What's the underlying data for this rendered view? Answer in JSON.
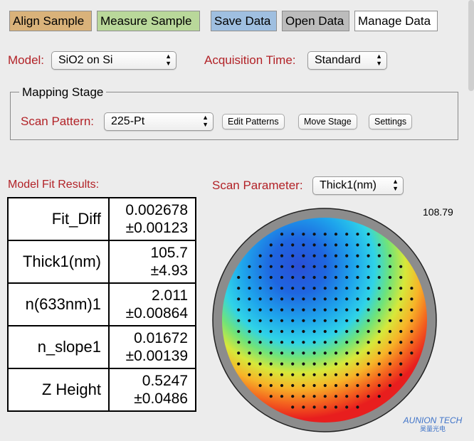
{
  "toolbar": {
    "align_sample": "Align Sample",
    "measure_sample": "Measure Sample",
    "save_data": "Save Data",
    "open_data": "Open Data",
    "manage_data": "Manage Data"
  },
  "model": {
    "label": "Model:",
    "value": "SiO2 on Si"
  },
  "acquisition": {
    "label": "Acquisition Time:",
    "value": "Standard"
  },
  "mapping_stage": {
    "legend": "Mapping Stage",
    "scan_pattern_label": "Scan Pattern:",
    "scan_pattern_value": "225-Pt",
    "edit_patterns": "Edit Patterns",
    "move_stage": "Move Stage",
    "settings": "Settings"
  },
  "results": {
    "title": "Model Fit Results:",
    "rows": [
      {
        "name": "Fit_Diff",
        "value": "0.002678",
        "error": "±0.00123"
      },
      {
        "name": "Thick1(nm)",
        "value": "105.7",
        "error": "±4.93"
      },
      {
        "name": "n(633nm)1",
        "value": "2.011",
        "error": "±0.00864"
      },
      {
        "name": "n_slope1",
        "value": "0.01672",
        "error": "±0.00139"
      },
      {
        "name": "Z Height",
        "value": "0.5247",
        "error": "±0.0486"
      }
    ]
  },
  "scan_parameter": {
    "label": "Scan Parameter:",
    "value": "Thick1(nm)"
  },
  "map": {
    "colorbar_max_label": "108.79",
    "watermark": "AUNION TECH",
    "watermark_sub": "昊量光电",
    "colors": {
      "wafer_edge": "#8c8c8c",
      "colorbar_top": "#e8201e",
      "colorbar_bottom": "#1a3fd1"
    }
  },
  "colors": {
    "label_red": "#b22227",
    "align_btn": "#d9b27a",
    "measure_btn": "#b9d89a",
    "save_btn": "#9fbfe0",
    "open_btn": "#bcbcbc"
  }
}
